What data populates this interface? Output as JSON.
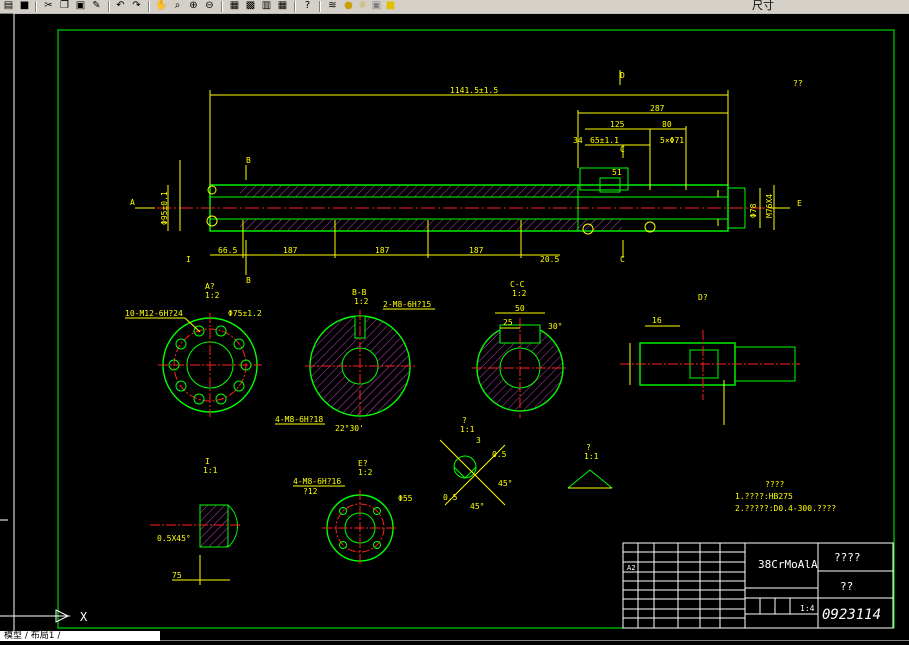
{
  "toolbar": {
    "icons": [
      "open-icon",
      "save-icon",
      "cut-icon",
      "copy-icon",
      "paste-icon",
      "match-props-icon",
      "undo-icon",
      "redo-icon",
      "pan-icon",
      "zoom-realtime-icon",
      "zoom-window-icon",
      "zoom-previous-icon",
      "properties-icon",
      "design-center-icon",
      "tool-palette-icon",
      "calc-icon",
      "help-icon",
      "layers-icon",
      "bulb-icon",
      "sun-icon",
      "lock-icon",
      "color-icon"
    ],
    "label": "尺寸"
  },
  "drawing": {
    "overall_length": "1141.5±1.5",
    "dim_287": "287",
    "dim_125": "125",
    "dim_80": "80",
    "dim_34": "34",
    "dim_65": "65±1.1",
    "dim_5x71": "5×Φ71",
    "dim_51": "51",
    "dim_66_5": "66.5",
    "dim_187a": "187",
    "dim_187b": "187",
    "dim_187c": "187",
    "dim_20_5": "20.5",
    "dim_phi95": "Φ95±0.1",
    "dim_phi78": "Φ78",
    "dim_m76": "M76X4",
    "view_A": "A",
    "view_E": "E",
    "view_B_top": "B",
    "view_B_bot": "B",
    "view_C_top": "C",
    "view_C_bot": "C",
    "view_D": "D",
    "roughness_top": "??",
    "label_I": "I",
    "section_A": "A?\n1:2",
    "section_A_title": "A?",
    "section_A_scale": "1:2",
    "section_BB_title": "B-B",
    "section_BB_scale": "1:2",
    "section_CC_title": "C-C",
    "section_CC_scale": "1:2",
    "section_D_title": "D?",
    "tap_10M12": "10-M12-6H?24",
    "dim_phi75": "Φ75±1.2",
    "tap_2M8": "2-M8-6H?15",
    "tap_4M8_BB": "4-M8-6H?18",
    "angle_22_30": "22°30'",
    "dim_50": "50",
    "dim_25": "25",
    "angle_30": "30°",
    "detail_I_title": "I",
    "detail_I_scale": "1:1",
    "detail_chamfer": "0.5X45°",
    "dim_75": "75",
    "section_E_title": "E?",
    "section_E_scale": "1:2",
    "tap_4M8_E": "4-M8-6H?16",
    "dim_12": "?12",
    "dim_phi55": "Φ55",
    "detail_q_title": "?",
    "detail_q_scale": "1:1",
    "dim_3": "3",
    "dim_0_5a": "0.5",
    "dim_0_5b": "0.5",
    "angle_45a": "45°",
    "angle_45b": "45°",
    "detail_r_title": "?",
    "detail_r_scale": "1:1",
    "dim_16": "16",
    "notes_title": "????",
    "note_1": "1.????:HB275",
    "note_2": "2.?????:D0.4-300.????",
    "material": "38CrMoAlA",
    "title_name": "????",
    "title_company": "??",
    "drawing_no": "0923114",
    "scale": "1:4",
    "title_a2": "A2"
  },
  "command_line": {
    "x_axis_label": "X",
    "tabs": "模型 / 布局1 /"
  }
}
